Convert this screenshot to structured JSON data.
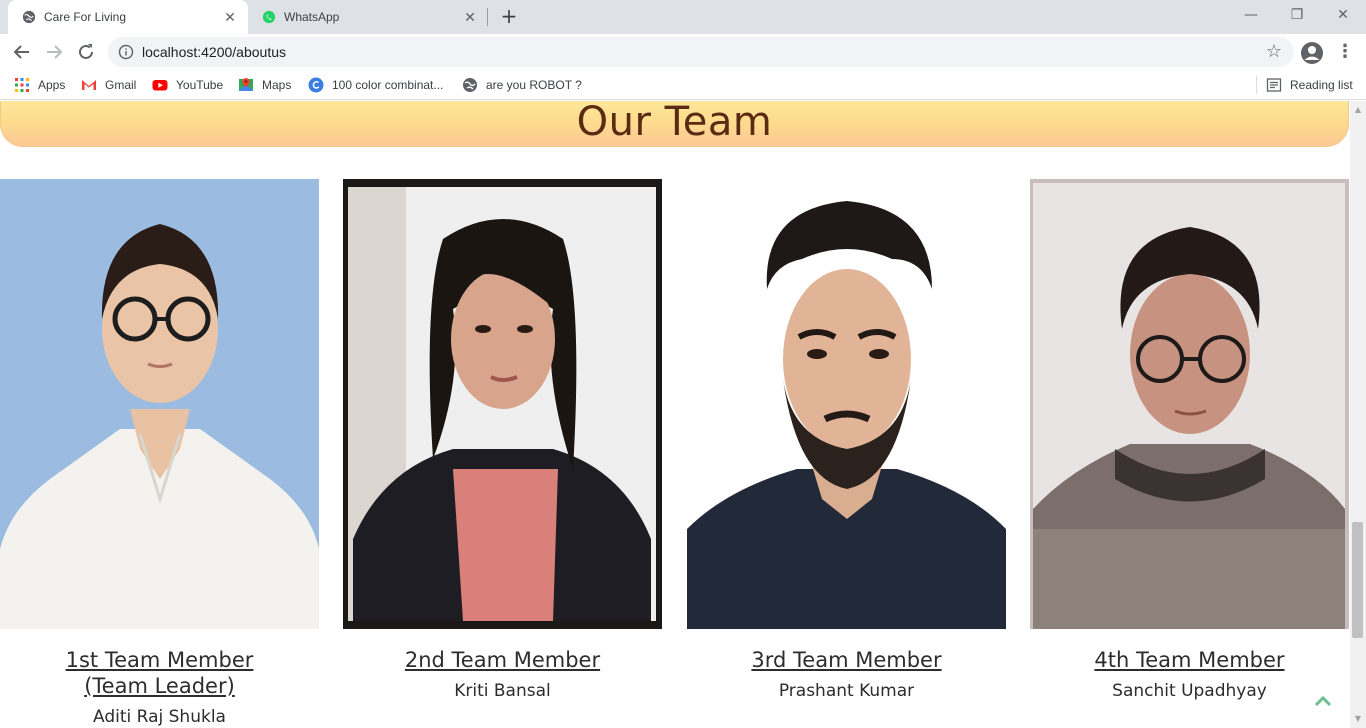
{
  "browser": {
    "tabs": [
      {
        "title": "Care For Living",
        "icon": "globe-icon",
        "active": true
      },
      {
        "title": "WhatsApp",
        "icon": "whatsapp-icon",
        "active": false
      }
    ],
    "new_tab": "+",
    "url": "localhost:4200/aboutus",
    "bookmarks": [
      {
        "label": "Apps",
        "icon": "apps-grid-icon"
      },
      {
        "label": "Gmail",
        "icon": "gmail-icon"
      },
      {
        "label": "YouTube",
        "icon": "youtube-icon"
      },
      {
        "label": "Maps",
        "icon": "maps-icon"
      },
      {
        "label": "100 color combinat...",
        "icon": "canva-icon"
      },
      {
        "label": "are you ROBOT ?",
        "icon": "globe-icon"
      }
    ],
    "reading_list": "Reading list"
  },
  "page": {
    "heading": "Our Team",
    "members": [
      {
        "role_line1": "1st Team Member",
        "role_line2": "(Team Leader)",
        "name": "Aditi Raj Shukla",
        "photo_bg": "#9bbce0"
      },
      {
        "role_line1": "2nd Team Member",
        "role_line2": "",
        "name": "Kriti Bansal",
        "photo_bg": "#efefef"
      },
      {
        "role_line1": "3rd Team Member",
        "role_line2": "",
        "name": "Prashant Kumar",
        "photo_bg": "#ffffff"
      },
      {
        "role_line1": "4th Team Member",
        "role_line2": "",
        "name": "Sanchit Upadhyay",
        "photo_bg": "#e8e4e4"
      }
    ]
  },
  "colors": {
    "heading_text": "#5b2a12",
    "heading_gradient_top": "#fde89a",
    "heading_gradient_bottom": "#fcc894",
    "back_to_top": "#6dc08d"
  }
}
